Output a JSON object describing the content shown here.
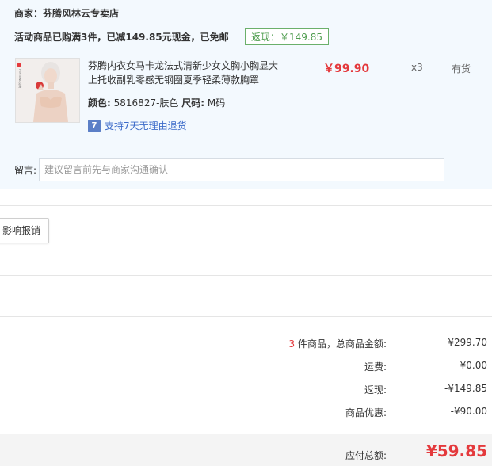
{
  "shop": {
    "name": "商家：芬腾风林云专卖店",
    "promo": "活动商品已购满3件，已减149.85元现金，已免邮",
    "rebate_tag": "返现：￥149.85"
  },
  "product": {
    "brand_mark": "FENTENG芬腾",
    "title": "芬腾内衣女马卡龙法式清新少女文胸小胸显大上托收副乳零感无钢圈夏季轻柔薄款胸罩",
    "color_label": "颜色:",
    "color_value": "5816827-肤色",
    "size_label": "尺码:",
    "size_value": "M码",
    "return_icon": "7",
    "return_policy": "支持7天无理由退货",
    "price": "￥99.90",
    "qty": "x3",
    "stock": "有货"
  },
  "message": {
    "label": "留言:",
    "placeholder": "建议留言前先与商家沟通确认",
    "value": ""
  },
  "invoice": {
    "button_label": "影响报销"
  },
  "summary": {
    "count": "3",
    "count_suffix": "件商品，总商品金额:",
    "goods_total": "¥299.70",
    "shipping_label": "运费:",
    "shipping_value": "¥0.00",
    "rebate_label": "返现:",
    "rebate_value": "-¥149.85",
    "discount_label": "商品优惠:",
    "discount_value": "-¥90.00",
    "total_label": "应付总额:",
    "total_value": "¥59.85"
  },
  "colors": {
    "price_red": "#e4393c",
    "rebate_green": "#4f9d4f",
    "panel_bg": "#f3f9fe",
    "link_blue": "#3c6bc9"
  }
}
